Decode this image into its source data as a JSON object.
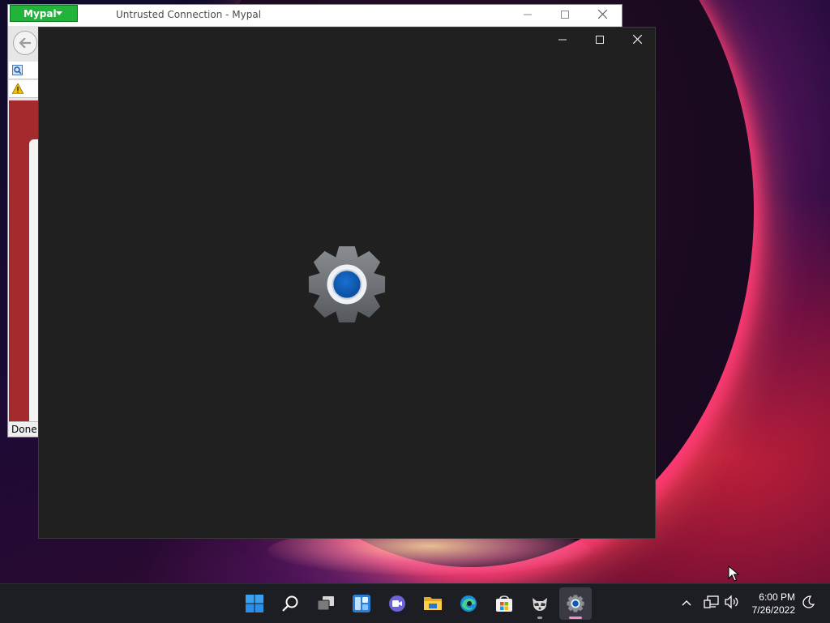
{
  "mypal": {
    "menu_label": "Mypal",
    "title": "Untrusted Connection - Mypal",
    "row_a_text": "",
    "row_b_text": "",
    "status_text": "Done"
  },
  "settings_window": {
    "icon": "settings-gear-icon",
    "controls": [
      "minimize",
      "maximize",
      "close"
    ]
  },
  "taskbar": {
    "apps": [
      {
        "name": "start",
        "icon": "windows-logo-icon"
      },
      {
        "name": "search",
        "icon": "search-icon"
      },
      {
        "name": "task-view",
        "icon": "task-view-icon"
      },
      {
        "name": "widgets",
        "icon": "widgets-icon"
      },
      {
        "name": "teams-chat",
        "icon": "camera-chat-icon"
      },
      {
        "name": "file-explorer",
        "icon": "folder-icon"
      },
      {
        "name": "edge",
        "icon": "edge-icon"
      },
      {
        "name": "store",
        "icon": "store-icon"
      },
      {
        "name": "mypal",
        "icon": "raccoon-icon",
        "running": true
      },
      {
        "name": "settings",
        "icon": "gear-icon",
        "running": true,
        "active": true
      }
    ],
    "clock": {
      "time": "6:00 PM",
      "date": "7/26/2022"
    }
  },
  "colors": {
    "accent": "#0067c0",
    "mypal_green": "#22b33a",
    "settings_bg": "#202020",
    "taskbar_bg": "#1d1d24",
    "active_indicator": "#f08fc8"
  }
}
